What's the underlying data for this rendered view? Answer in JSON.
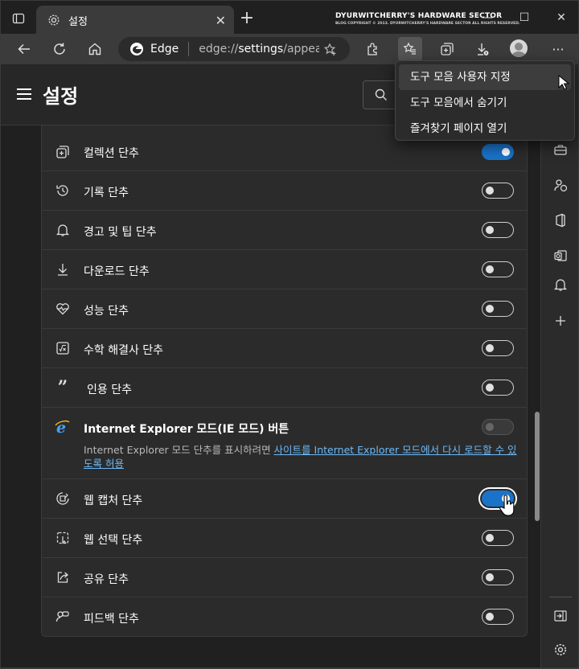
{
  "titlebar": {
    "tab_title": "설정",
    "tab_close": "✕",
    "new_tab": "+",
    "banner_title": "DYURWITCHERRY'S HARDWARE SECTOR",
    "banner_sub": "BLOG COPYRIGHT © 2013. DYURWITCHERRY'S HARDWARE SECTOR ALL RIGHTS RESERVED.",
    "minimize": "—",
    "maximize": "☐",
    "close": "✕"
  },
  "toolbar": {
    "edge_label": "Edge",
    "url_prefix": "edge://",
    "url_host": "settings",
    "url_rest": "/appea...",
    "more": "···"
  },
  "settings": {
    "title": "설정"
  },
  "rows": [
    {
      "label": "컬렉션 단추",
      "icon": "collections-icon",
      "state": "on"
    },
    {
      "label": "기록 단추",
      "icon": "history-icon",
      "state": "off"
    },
    {
      "label": "경고 및 팁 단추",
      "icon": "bell-icon",
      "state": "off"
    },
    {
      "label": "다운로드 단추",
      "icon": "download-icon",
      "state": "off"
    },
    {
      "label": "성능 단추",
      "icon": "performance-icon",
      "state": "off"
    },
    {
      "label": "수학 해결사 단추",
      "icon": "math-solver-icon",
      "state": "off"
    },
    {
      "label": "인용 단추",
      "icon": "quote-icon",
      "state": "off"
    },
    {
      "label": "Internet Explorer 모드(IE 모드) 버튼",
      "icon": "ie-icon",
      "state": "disabled",
      "desc": "Internet Explorer 모드 단추를 표시하려면 ",
      "desc_link": "사이트를 Internet Explorer 모드에서 다시 로드할 수 있도록 허용"
    },
    {
      "label": "웹 캡처 단추",
      "icon": "web-capture-icon",
      "state": "on"
    },
    {
      "label": "웹 선택 단추",
      "icon": "web-select-icon",
      "state": "off"
    },
    {
      "label": "공유 단추",
      "icon": "share-icon",
      "state": "off"
    },
    {
      "label": "피드백 단추",
      "icon": "feedback-icon",
      "state": "off"
    }
  ],
  "dropdown": {
    "items": [
      "도구 모음 사용자 지정",
      "도구 모음에서 숨기기",
      "즐겨찾기 페이지 열기"
    ]
  },
  "colors": {
    "accent": "#1a73c9",
    "link": "#6cb8f6",
    "background": "#202020",
    "panel": "#2b2b2b"
  }
}
